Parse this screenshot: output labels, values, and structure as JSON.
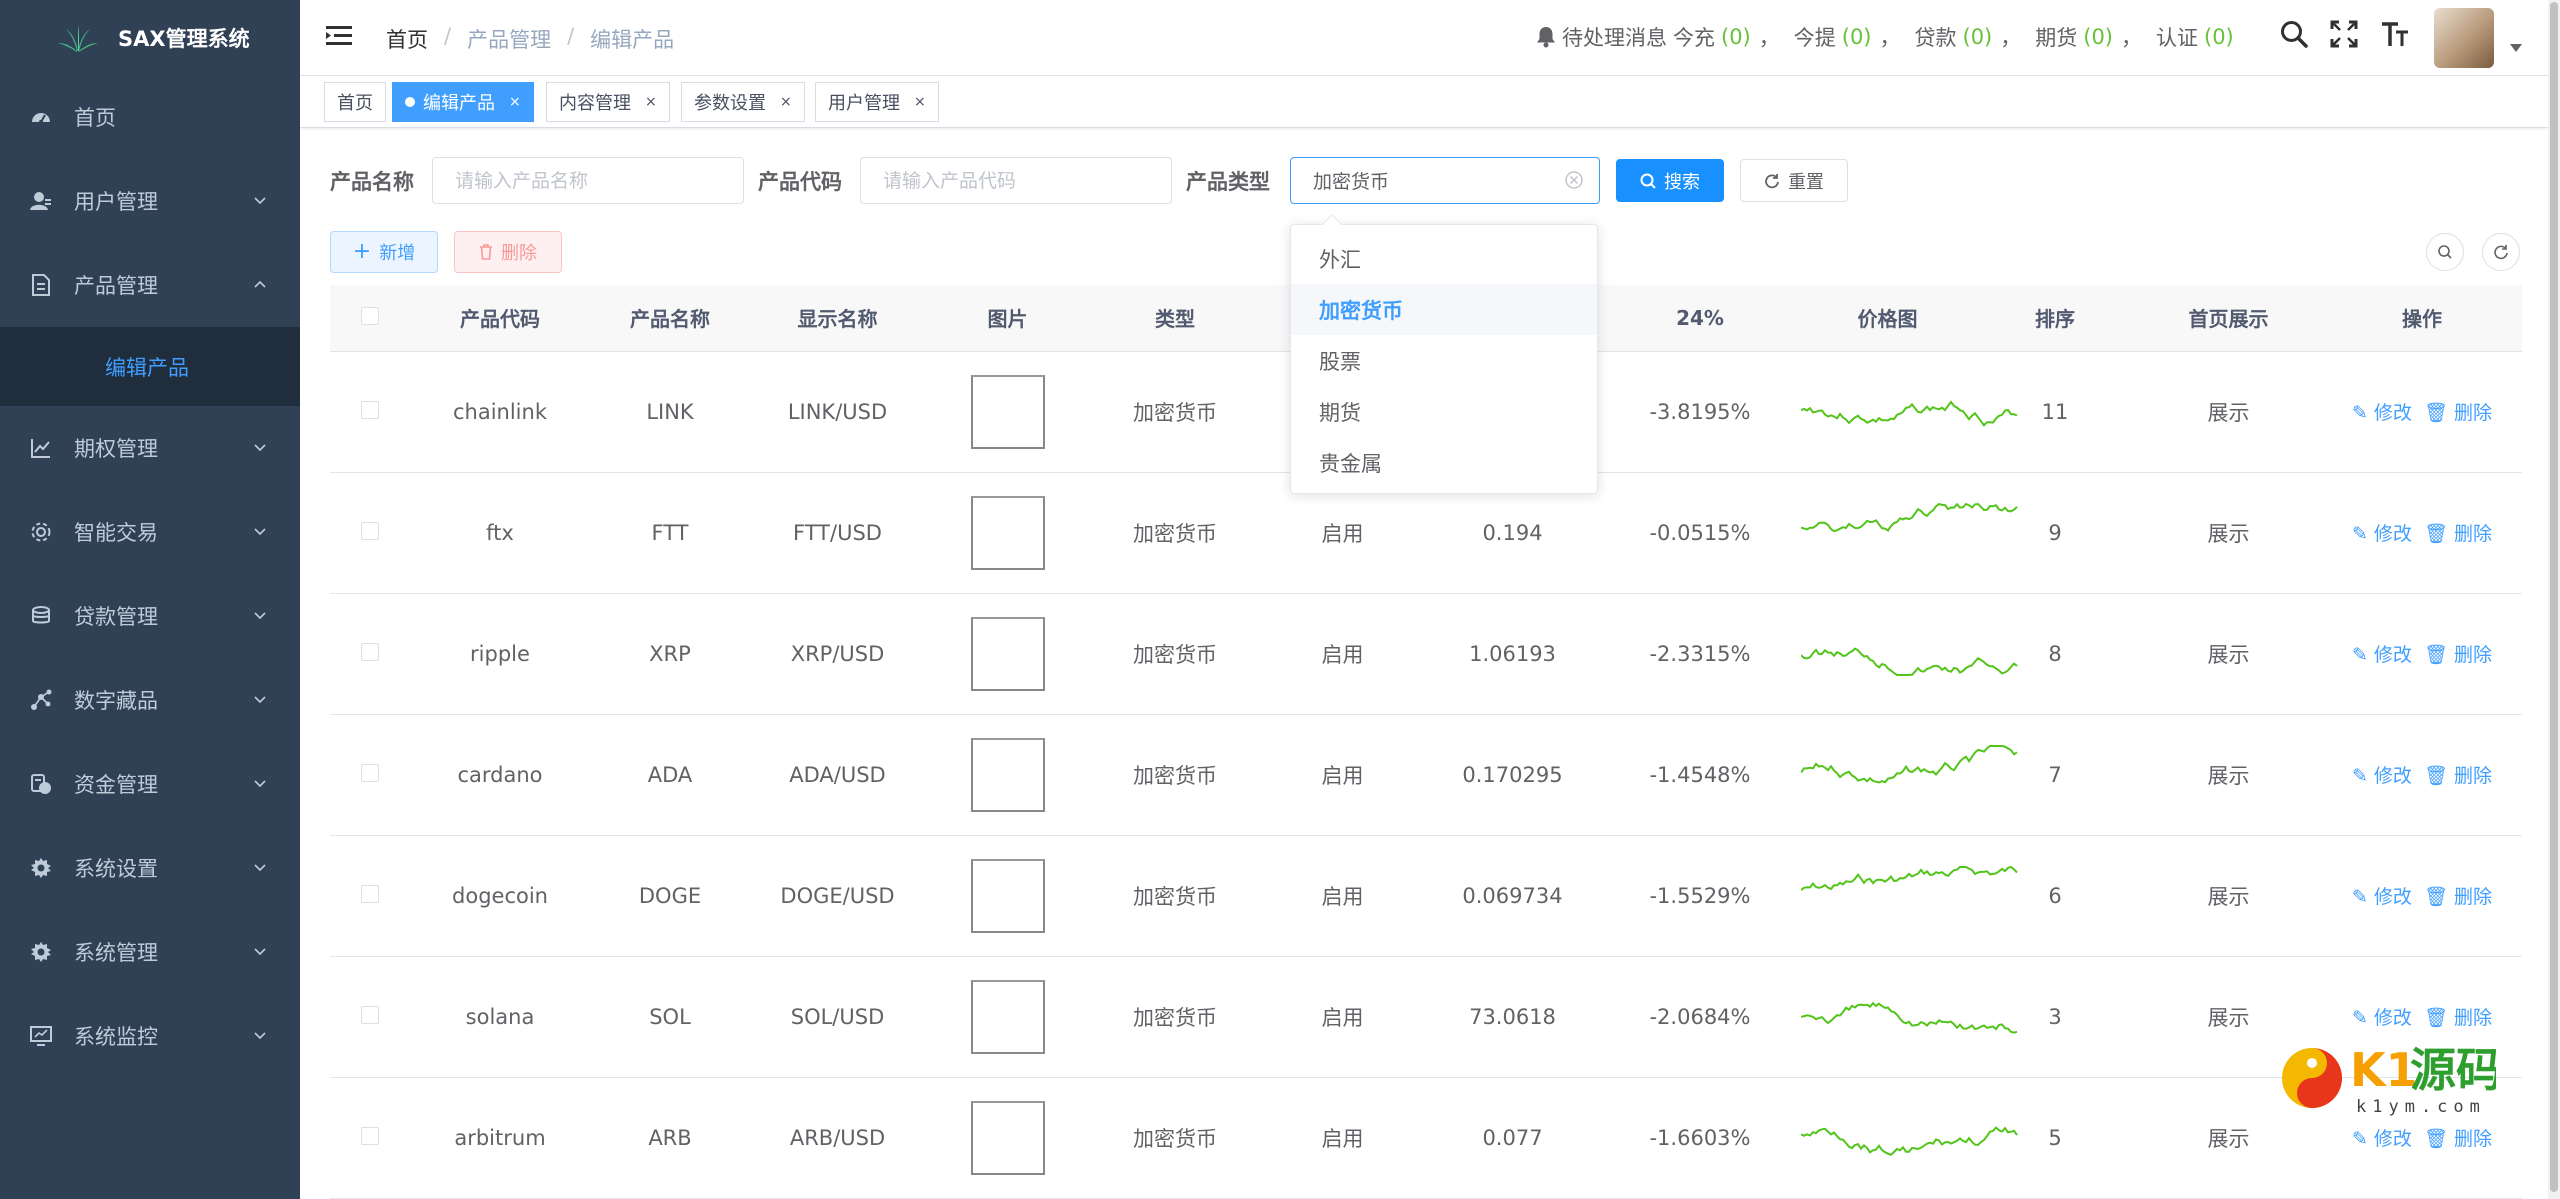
{
  "app": {
    "title": "SAX管理系统"
  },
  "sidebar": {
    "items": [
      {
        "label": "首页",
        "icon": "dashboard-icon"
      },
      {
        "label": "用户管理",
        "icon": "user-icon"
      },
      {
        "label": "产品管理",
        "icon": "document-icon",
        "expanded": true
      },
      {
        "label": "期权管理",
        "icon": "chart-icon"
      },
      {
        "label": "智能交易",
        "icon": "settings-icon"
      },
      {
        "label": "贷款管理",
        "icon": "coins-icon"
      },
      {
        "label": "数字藏品",
        "icon": "nodes-icon"
      },
      {
        "label": "资金管理",
        "icon": "money-icon"
      },
      {
        "label": "系统设置",
        "icon": "gear-icon"
      },
      {
        "label": "系统管理",
        "icon": "gear-icon"
      },
      {
        "label": "系统监控",
        "icon": "monitor-icon"
      }
    ],
    "sub_item": {
      "label": "编辑产品"
    }
  },
  "header": {
    "breadcrumb": [
      "首页",
      "产品管理",
      "编辑产品"
    ],
    "notice": {
      "label": "待处理消息",
      "items": [
        {
          "label": "今充",
          "count": "(0)"
        },
        {
          "label": "今提",
          "count": "(0)"
        },
        {
          "label": "贷款",
          "count": "(0)"
        },
        {
          "label": "期货",
          "count": "(0)"
        },
        {
          "label": "认证",
          "count": "(0)"
        }
      ],
      "separator": "，"
    }
  },
  "tags": [
    {
      "label": "首页",
      "active": false
    },
    {
      "label": "编辑产品",
      "active": true,
      "close": "×"
    },
    {
      "label": "内容管理",
      "active": false,
      "close": "×"
    },
    {
      "label": "参数设置",
      "active": false,
      "close": "×"
    },
    {
      "label": "用户管理",
      "active": false,
      "close": "×"
    }
  ],
  "search": {
    "name_label": "产品名称",
    "name_placeholder": "请输入产品名称",
    "code_label": "产品代码",
    "code_placeholder": "请输入产品代码",
    "type_label": "产品类型",
    "type_value": "加密货币",
    "search_button": "搜索",
    "reset_button": "重置"
  },
  "toolbar": {
    "add_button": "新增",
    "delete_button": "删除"
  },
  "dropdown": {
    "options": [
      "外汇",
      "加密货币",
      "股票",
      "期货",
      "贵金属"
    ],
    "selected": "加密货币"
  },
  "table": {
    "columns": [
      "产品代码",
      "产品名称",
      "显示名称",
      "图片",
      "类型",
      "",
      "",
      "24%",
      "价格图",
      "排序",
      "首页展示",
      "操作"
    ],
    "rows": [
      {
        "code": "chainlink",
        "name": "LINK",
        "display": "LINK/USD",
        "type": "加密货币",
        "status": "",
        "price": "",
        "change": "-3.8195%",
        "sort": "11",
        "home": "展示"
      },
      {
        "code": "ftx",
        "name": "FTT",
        "display": "FTT/USD",
        "type": "加密货币",
        "status": "启用",
        "price": "0.194",
        "change": "-0.0515%",
        "sort": "9",
        "home": "展示"
      },
      {
        "code": "ripple",
        "name": "XRP",
        "display": "XRP/USD",
        "type": "加密货币",
        "status": "启用",
        "price": "1.06193",
        "change": "-2.3315%",
        "sort": "8",
        "home": "展示"
      },
      {
        "code": "cardano",
        "name": "ADA",
        "display": "ADA/USD",
        "type": "加密货币",
        "status": "启用",
        "price": "0.170295",
        "change": "-1.4548%",
        "sort": "7",
        "home": "展示"
      },
      {
        "code": "dogecoin",
        "name": "DOGE",
        "display": "DOGE/USD",
        "type": "加密货币",
        "status": "启用",
        "price": "0.069734",
        "change": "-1.5529%",
        "sort": "6",
        "home": "展示"
      },
      {
        "code": "solana",
        "name": "SOL",
        "display": "SOL/USD",
        "type": "加密货币",
        "status": "启用",
        "price": "73.0618",
        "change": "-2.0684%",
        "sort": "3",
        "home": "展示"
      },
      {
        "code": "arbitrum",
        "name": "ARB",
        "display": "ARB/USD",
        "type": "加密货币",
        "status": "启用",
        "price": "0.077",
        "change": "-1.6603%",
        "sort": "5",
        "home": "展示"
      }
    ],
    "edit_label": "修改",
    "delete_label": "删除"
  },
  "watermark": {
    "brand": "K1源码",
    "domain": "k1ym.com"
  },
  "colors": {
    "sidebar_bg": "#304156",
    "accent": "#409eff",
    "negative": "#13a513",
    "sparkline": "#52c41a"
  }
}
